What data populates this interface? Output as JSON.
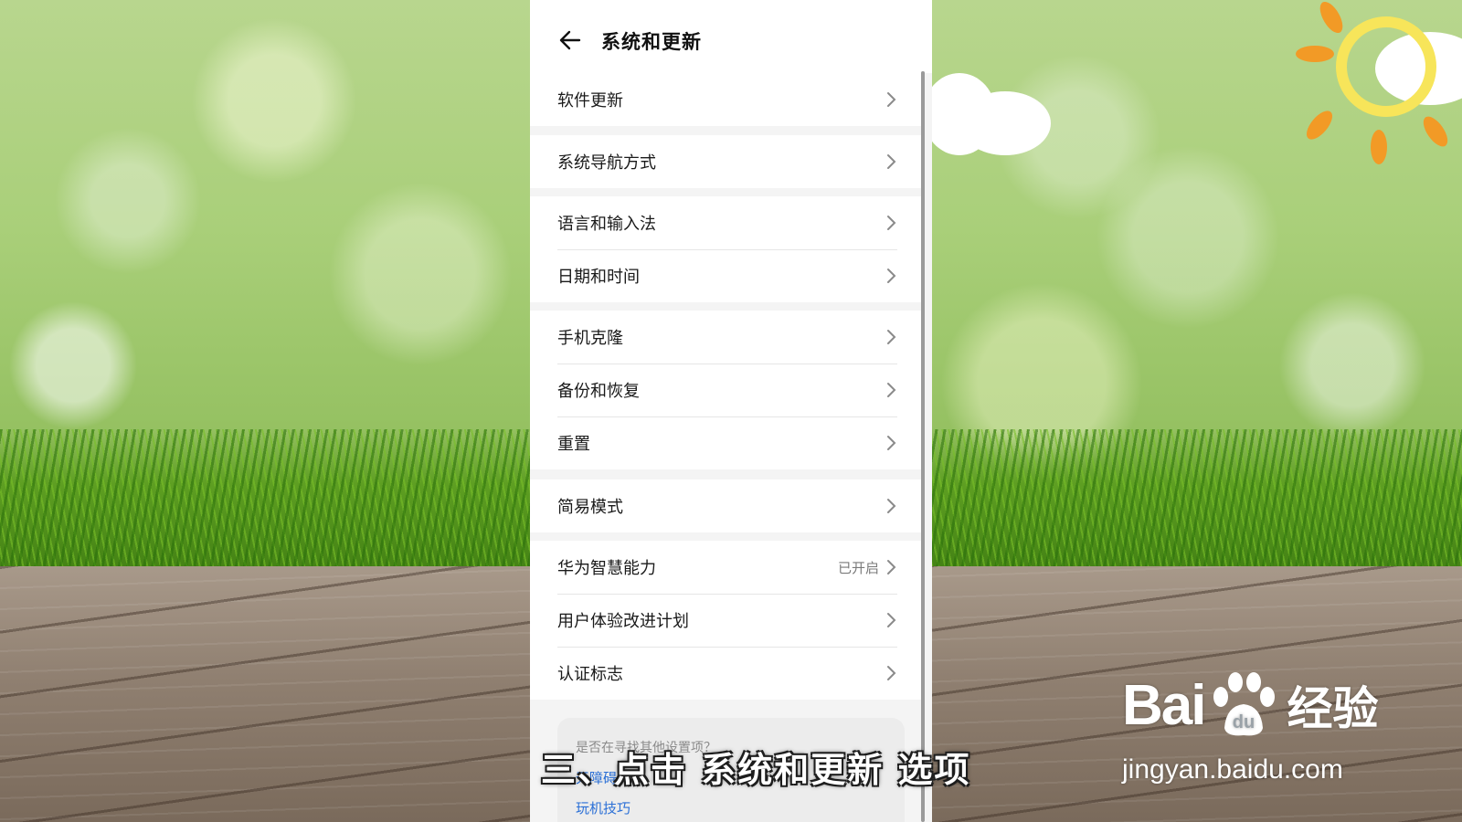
{
  "header": {
    "title": "系统和更新"
  },
  "groups": [
    {
      "items": [
        {
          "label": "软件更新"
        }
      ]
    },
    {
      "items": [
        {
          "label": "系统导航方式"
        }
      ]
    },
    {
      "items": [
        {
          "label": "语言和输入法"
        },
        {
          "label": "日期和时间"
        }
      ]
    },
    {
      "items": [
        {
          "label": "手机克隆"
        },
        {
          "label": "备份和恢复"
        },
        {
          "label": "重置"
        }
      ]
    },
    {
      "items": [
        {
          "label": "简易模式"
        }
      ]
    },
    {
      "items": [
        {
          "label": "华为智慧能力",
          "value": "已开启"
        },
        {
          "label": "用户体验改进计划"
        },
        {
          "label": "认证标志"
        }
      ]
    }
  ],
  "tips": {
    "question": "是否在寻找其他设置项？",
    "link1": "无障碍",
    "link2": "玩机技巧"
  },
  "subtitle": "三、点击 系统和更新 选项",
  "watermark": {
    "brand": "Bai",
    "brand_cn": "经验",
    "url": "jingyan.baidu.com"
  },
  "colors": {
    "link": "#2a6fd6",
    "page_bg": "#f4f4f4"
  }
}
